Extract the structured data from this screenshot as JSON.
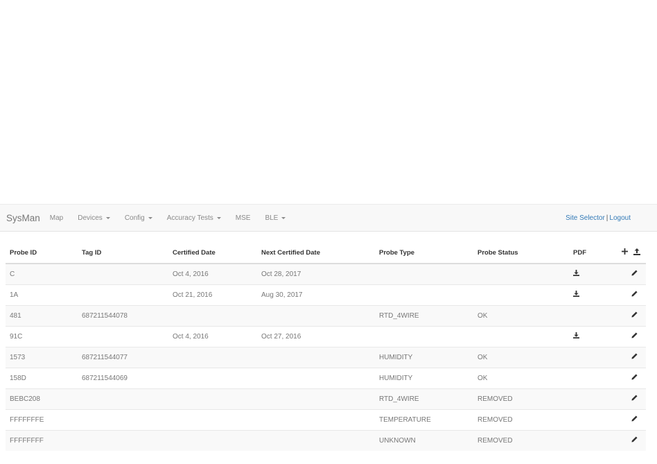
{
  "navbar": {
    "brand": "SysMan",
    "items": [
      {
        "label": "Map",
        "dropdown": false
      },
      {
        "label": "Devices",
        "dropdown": true
      },
      {
        "label": "Config",
        "dropdown": true
      },
      {
        "label": "Accuracy Tests",
        "dropdown": true
      },
      {
        "label": "MSE",
        "dropdown": false
      },
      {
        "label": "BLE",
        "dropdown": true
      }
    ],
    "site_selector": "Site Selector",
    "separator": "|",
    "logout": "Logout"
  },
  "table": {
    "columns": [
      "Probe ID",
      "Tag ID",
      "Certified Date",
      "Next Certified Date",
      "Probe Type",
      "Probe Status",
      "PDF"
    ],
    "header_icons": [
      "plus-icon",
      "upload-icon"
    ],
    "rows": [
      {
        "probe_id": "C",
        "tag_id": "",
        "certified": "Oct 4, 2016",
        "next_certified": "Oct 28, 2017",
        "type": "",
        "status": "",
        "pdf": true
      },
      {
        "probe_id": "1A",
        "tag_id": "",
        "certified": "Oct 21, 2016",
        "next_certified": "Aug 30, 2017",
        "type": "",
        "status": "",
        "pdf": true
      },
      {
        "probe_id": "481",
        "tag_id": "687211544078",
        "certified": "",
        "next_certified": "",
        "type": "RTD_4WIRE",
        "status": "OK",
        "pdf": false
      },
      {
        "probe_id": "91C",
        "tag_id": "",
        "certified": "Oct 4, 2016",
        "next_certified": "Oct 27, 2016",
        "type": "",
        "status": "",
        "pdf": true
      },
      {
        "probe_id": "1573",
        "tag_id": "687211544077",
        "certified": "",
        "next_certified": "",
        "type": "HUMIDITY",
        "status": "OK",
        "pdf": false
      },
      {
        "probe_id": "158D",
        "tag_id": "687211544069",
        "certified": "",
        "next_certified": "",
        "type": "HUMIDITY",
        "status": "OK",
        "pdf": false
      },
      {
        "probe_id": "BEBC208",
        "tag_id": "",
        "certified": "",
        "next_certified": "",
        "type": "RTD_4WIRE",
        "status": "REMOVED",
        "pdf": false
      },
      {
        "probe_id": "FFFFFFFE",
        "tag_id": "",
        "certified": "",
        "next_certified": "",
        "type": "TEMPERATURE",
        "status": "REMOVED",
        "pdf": false
      },
      {
        "probe_id": "FFFFFFFF",
        "tag_id": "",
        "certified": "",
        "next_certified": "",
        "type": "UNKNOWN",
        "status": "REMOVED",
        "pdf": false
      }
    ],
    "row_icons": {
      "pdf": "download-icon",
      "action": "pencil-icon"
    }
  },
  "colors": {
    "link": "#337ab7",
    "navbar_bg": "#f8f8f8",
    "row_stripe": "#f9f9f9"
  }
}
